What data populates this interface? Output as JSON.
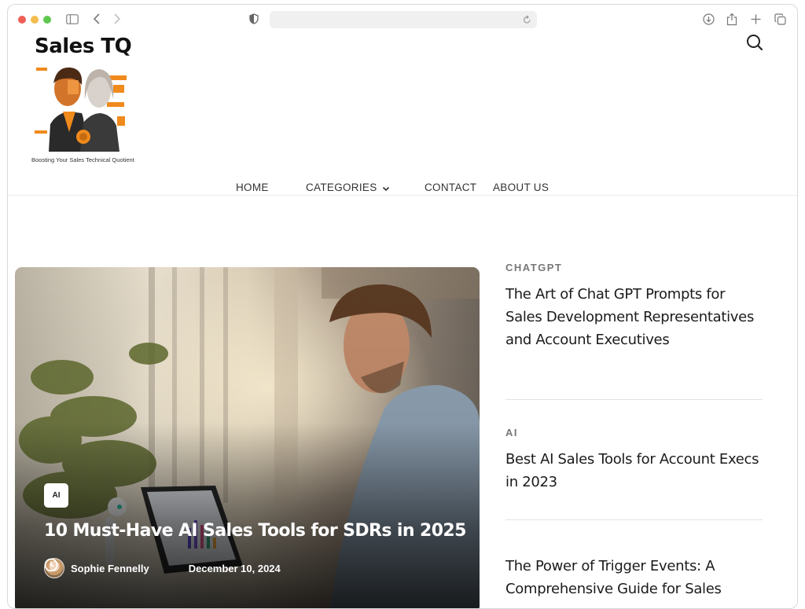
{
  "browser": {
    "traffic_lights": [
      "#ee5f57",
      "#f5bd4f",
      "#5ec84e"
    ],
    "icons": [
      "sidebar-icon",
      "back-icon",
      "forward-icon",
      "shield-icon",
      "reload-icon",
      "download-icon",
      "share-icon",
      "new-tab-icon",
      "tabs-overview-icon"
    ],
    "address_value": ""
  },
  "site": {
    "logo_title": "Sales TQ",
    "tagline": "Boosting Your Sales Technical Quotient",
    "brand_accent": "#f08a1c"
  },
  "nav": {
    "items": [
      {
        "label": "HOME"
      },
      {
        "label": "CATEGORIES",
        "has_dropdown": true
      },
      {
        "label": "CONTACT"
      },
      {
        "label": "ABOUT US"
      }
    ]
  },
  "hero": {
    "badge": "AI",
    "title": "10 Must-Have AI Sales Tools for SDRs in 2025",
    "author": "Sophie Fennelly",
    "date": "December 10, 2024"
  },
  "sidebar_posts": [
    {
      "category": "CHATGPT",
      "title": "The Art of Chat GPT Prompts for Sales Development Representatives and Account Executives"
    },
    {
      "category": "AI",
      "title": "Best AI Sales Tools for Account Execs in 2023"
    },
    {
      "category": "",
      "title": "The Power of Trigger Events: A Comprehensive Guide for Sales"
    }
  ]
}
